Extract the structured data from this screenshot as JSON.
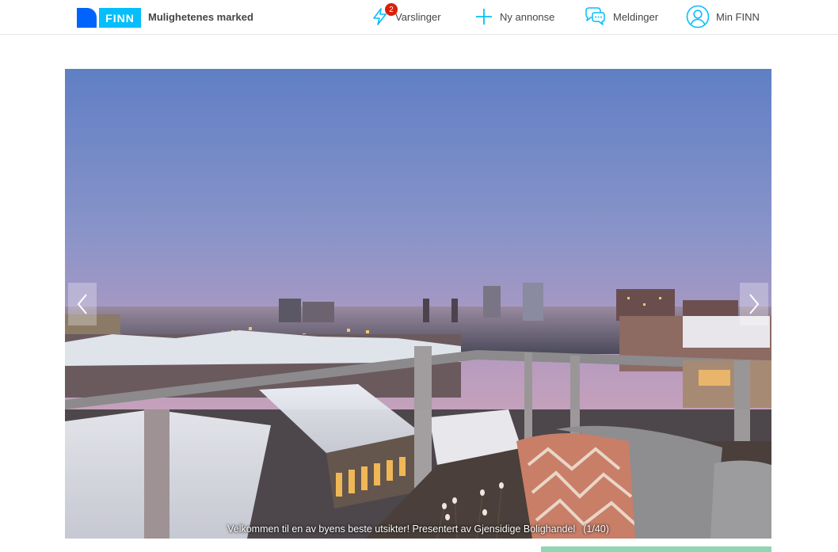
{
  "header": {
    "logo_text": "FINN",
    "tagline": "Mulighetenes marked",
    "nav": {
      "notifications": {
        "label": "Varslinger",
        "badge": "2"
      },
      "new_ad": {
        "label": "Ny annonse"
      },
      "messages": {
        "label": "Meldinger"
      },
      "account": {
        "label": "Min FINN"
      }
    }
  },
  "gallery": {
    "caption": "Velkommen til en av byens beste utsikter! Presentert av Gjensidige Bolighandel",
    "counter": "(1/40)"
  },
  "colors": {
    "brand_dark": "#0063fb",
    "brand_light": "#06befb",
    "badge": "#d91f0a",
    "icon": "#06befb",
    "cta_strip": "#8fd6b2"
  },
  "icons": {
    "notifications": "lightning-icon",
    "new_ad": "plus-icon",
    "messages": "chat-bubbles-icon",
    "account": "user-circle-icon",
    "prev": "chevron-left-icon",
    "next": "chevron-right-icon"
  }
}
